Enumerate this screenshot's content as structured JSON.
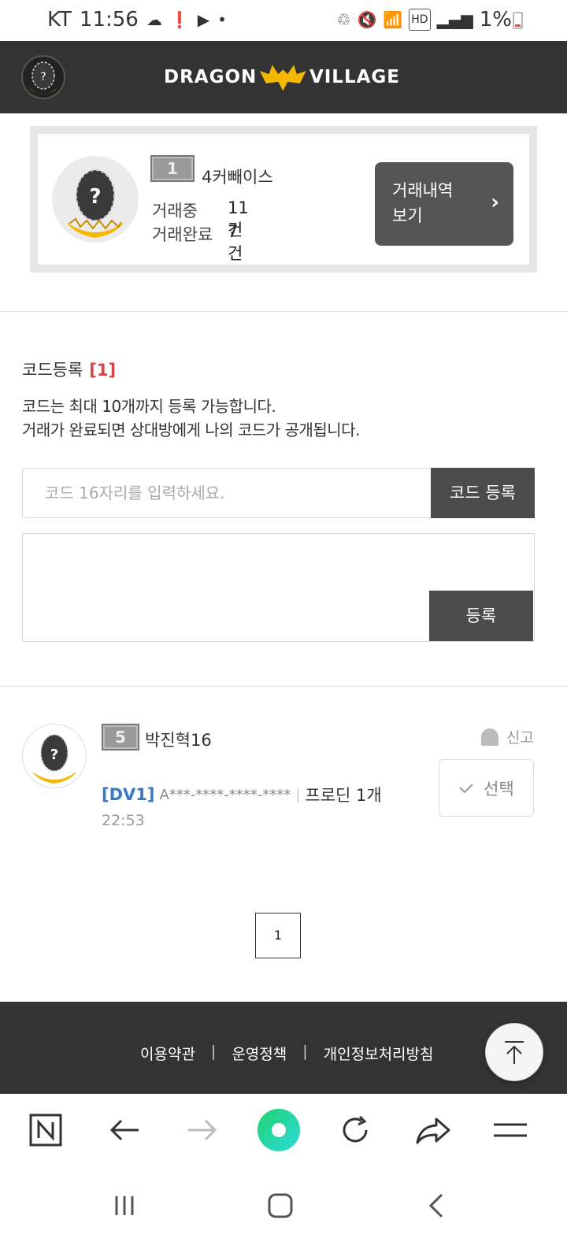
{
  "status_bar": {
    "carrier": "KT",
    "time": "11:56",
    "battery": "1%"
  },
  "header": {
    "logo_left": "DRAGON",
    "logo_right": "VILLAGE",
    "avatar_mark": "?"
  },
  "profile": {
    "level": "1",
    "name": "4커빼이스",
    "avatar_mark": "?",
    "trading_label": "거래중",
    "trading_count": "11건",
    "completed_label": "거래완료",
    "completed_count": "7건",
    "history_button": "거래내역\n보기",
    "history_line1": "거래내역",
    "history_line2": "보기"
  },
  "code_section": {
    "title": "코드등록",
    "count": "[1]",
    "desc_line1": "코드는 최대 10개까지 등록 가능합니다.",
    "desc_line2": "거래가 완료되면 상대방에게 나의 코드가 공개됩니다.",
    "input_placeholder": "코드 16자리를 입력하세요.",
    "input_value": "",
    "code_button": "코드 등록",
    "register_button": "등록"
  },
  "list": [
    {
      "level": "5",
      "name": "박진혁16",
      "avatar_mark": "?",
      "report": "신고",
      "select": "선택",
      "tag": "[DV1]",
      "code": "A***-****-****-****",
      "item": "프로딘 1개",
      "time": "22:53"
    }
  ],
  "pagination": {
    "current": "1"
  },
  "footer": {
    "links": [
      "이용약관",
      "운영정책",
      "개인정보처리방침"
    ],
    "separator": "|"
  },
  "colors": {
    "header_bg": "#333333",
    "accent_red": "#d64545",
    "tag_blue": "#3a78c8",
    "button_dark": "#4b4b4b",
    "browser_green": "#2bd9a0"
  }
}
